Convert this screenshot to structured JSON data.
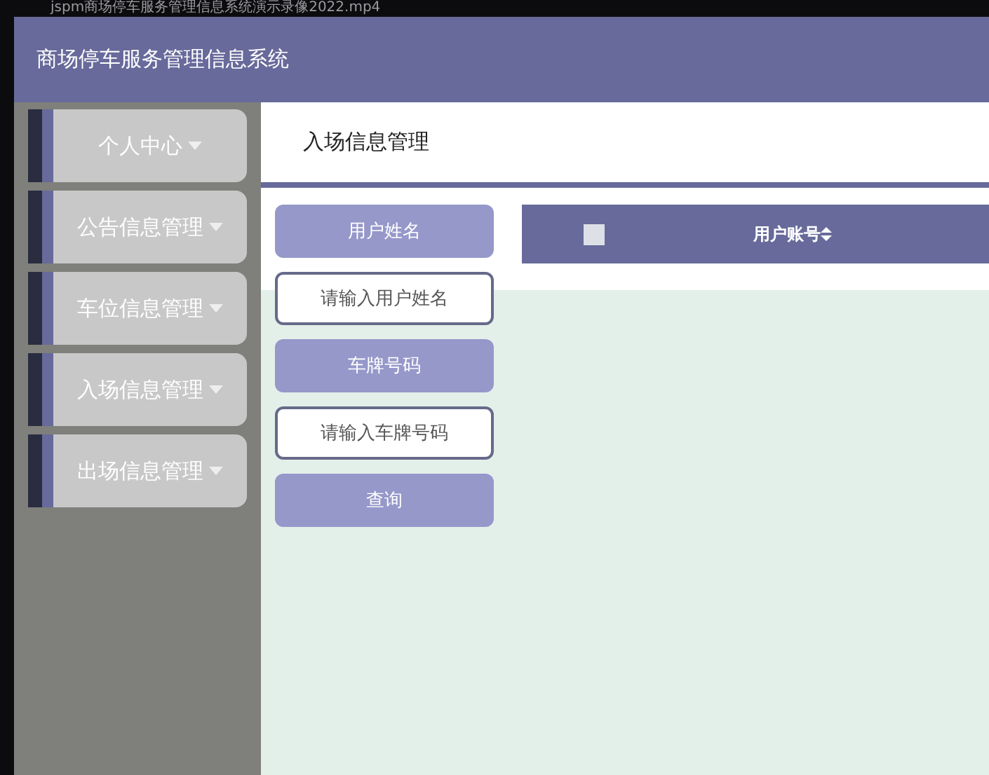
{
  "video_title": "jspm商场停车服务管理信息系统演示录像2022.mp4",
  "header": {
    "title": "商场停车服务管理信息系统"
  },
  "sidebar": {
    "items": [
      {
        "label": "个人中心"
      },
      {
        "label": "公告信息管理"
      },
      {
        "label": "车位信息管理"
      },
      {
        "label": "入场信息管理"
      },
      {
        "label": "出场信息管理"
      }
    ]
  },
  "breadcrumb": "入场信息管理",
  "search_form": {
    "fields": [
      {
        "label": "用户姓名",
        "placeholder": "请输入用户姓名"
      },
      {
        "label": "车牌号码",
        "placeholder": "请输入车牌号码"
      }
    ],
    "button": "查询"
  },
  "table": {
    "select_all_checked": false,
    "columns": [
      {
        "label": "用户账号",
        "sortable": true
      }
    ]
  }
}
